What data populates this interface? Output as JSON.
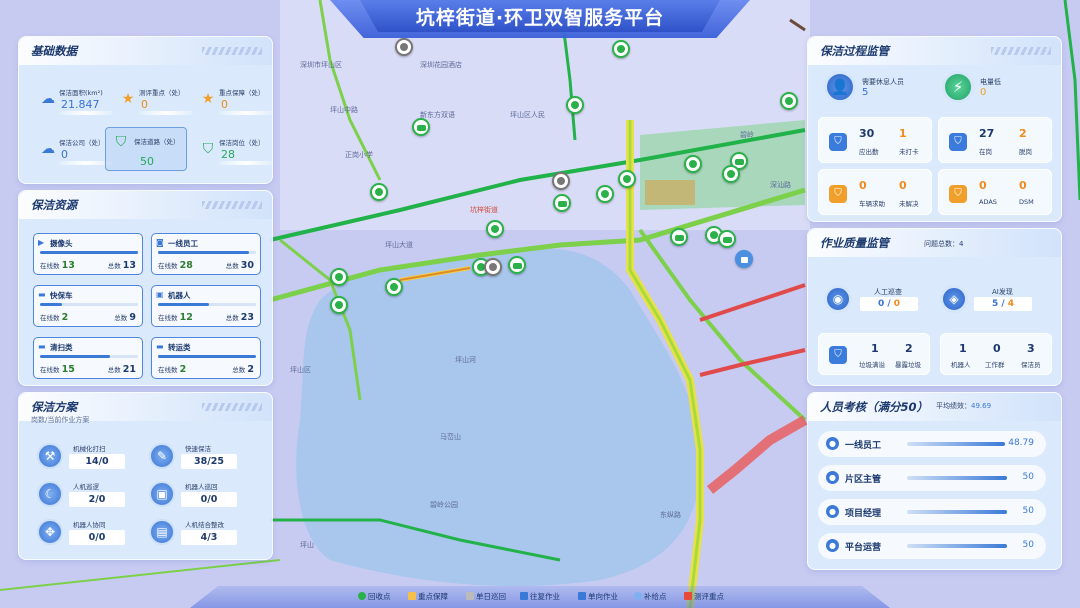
{
  "header": {
    "title": "坑梓街道·环卫双智服务平台"
  },
  "map": {
    "labels": [
      "深圳市坪山区",
      "坪山中路",
      "龙兴路",
      "深圳花园酒店",
      "坪山区人民",
      "新东方双语",
      "深圳·",
      "坪山河",
      "坪山大道",
      "东纵路",
      "深汕路",
      "碧岭",
      "马峦山",
      "坪山区",
      "坪山",
      "正岗小学",
      "碧岭公园"
    ],
    "red_label": "坑梓街道"
  },
  "basic": {
    "title": "基础数据",
    "items": [
      {
        "icon": "cloud-icon",
        "label": "保洁面积(km²)",
        "value": "21.847"
      },
      {
        "icon": "star-icon",
        "label": "测评重点（处）",
        "value": "0"
      },
      {
        "icon": "star-icon",
        "label": "重点保障（处）",
        "value": "0"
      },
      {
        "icon": "cloud-icon",
        "label": "保洁公司（处）",
        "value": "0"
      },
      {
        "icon": "shield-icon",
        "label": "保洁道路（处）",
        "value": "50"
      },
      {
        "icon": "shield-icon",
        "label": "保洁岗位（处）",
        "value": "28"
      }
    ]
  },
  "resources": {
    "title": "保洁资源",
    "online_label": "在线数",
    "total_label": "总数",
    "items": [
      {
        "name": "摄像头",
        "icon": "camera-icon",
        "online": "13",
        "total": "13",
        "ratio": 1.0
      },
      {
        "name": "一线员工",
        "icon": "person-icon",
        "online": "28",
        "total": "30",
        "ratio": 0.93
      },
      {
        "name": "快保车",
        "icon": "truck-icon",
        "online": "2",
        "total": "9",
        "ratio": 0.22
      },
      {
        "name": "机器人",
        "icon": "robot-icon",
        "online": "12",
        "total": "23",
        "ratio": 0.52
      },
      {
        "name": "清扫类",
        "icon": "sweeper-icon",
        "online": "15",
        "total": "21",
        "ratio": 0.71
      },
      {
        "name": "转运类",
        "icon": "transport-icon",
        "online": "2",
        "total": "2",
        "ratio": 1.0
      }
    ]
  },
  "plan": {
    "title": "保洁方案",
    "subtitle": "岗数/当前作业方案",
    "items": [
      {
        "label": "机械化打扫",
        "value": "14/0",
        "icon": "broom-icon"
      },
      {
        "label": "快速保洁",
        "value": "38/25",
        "icon": "brush-icon"
      },
      {
        "label": "人机巡逻",
        "value": "2/0",
        "icon": "patrol-icon"
      },
      {
        "label": "机器人巡回",
        "value": "0/0",
        "icon": "robot-icon"
      },
      {
        "label": "机器人协同",
        "value": "0/0",
        "icon": "network-icon"
      },
      {
        "label": "人机结合整改",
        "value": "4/3",
        "icon": "tablet-icon"
      }
    ]
  },
  "process": {
    "title": "保洁过程监管",
    "top": [
      {
        "label": "需要休息人员",
        "value": "5",
        "icon": "user-icon"
      },
      {
        "label": "电量低",
        "value": "0",
        "icon": "battery-icon"
      }
    ],
    "cards": [
      {
        "icon": "shield-user-icon",
        "a_value": "30",
        "a_label": "应出勤",
        "b_value": "1",
        "b_label": "未打卡",
        "accent": "blue"
      },
      {
        "icon": "shield-user-icon",
        "a_value": "27",
        "a_label": "在岗",
        "b_value": "2",
        "b_label": "脱岗",
        "accent": "blue"
      },
      {
        "icon": "shield-alert-icon",
        "a_value": "0",
        "a_label": "车辆求助",
        "b_value": "0",
        "b_label": "未解决",
        "accent": "orange"
      },
      {
        "icon": "shield-alert-icon",
        "a_value": "0",
        "a_label": "ADAS",
        "b_value": "0",
        "b_label": "DSM",
        "accent": "orange"
      }
    ]
  },
  "quality": {
    "title": "作业质量监管",
    "problems_label": "问题总数：",
    "problems_value": "4",
    "top": [
      {
        "label": "人工巡查",
        "a": "0",
        "b": "0",
        "icon": "person-check-icon"
      },
      {
        "label": "AI发现",
        "a": "5",
        "b": "4",
        "icon": "ai-icon"
      }
    ],
    "cards": [
      {
        "icon": "shield-icon",
        "values": [
          "1",
          "2"
        ],
        "labels": [
          "垃圾满溢",
          "暴露垃圾"
        ]
      },
      {
        "icon": "people-icon",
        "values": [
          "1",
          "0",
          "3"
        ],
        "labels": [
          "机器人",
          "工作群",
          "保洁员"
        ]
      }
    ]
  },
  "assessment": {
    "title": "人员考核（满分50）",
    "avg_label": "平均绩效：",
    "avg_value": "49.69",
    "rows": [
      {
        "name": "一线员工",
        "value": "48.79",
        "ratio": 0.976
      },
      {
        "name": "片区主管",
        "value": "50",
        "ratio": 1.0
      },
      {
        "name": "项目经理",
        "value": "50",
        "ratio": 1.0
      },
      {
        "name": "平台运营",
        "value": "50",
        "ratio": 1.0
      }
    ]
  },
  "legend": {
    "items": [
      {
        "label": "回收点",
        "color": "#2bb14a"
      },
      {
        "label": "重点保障",
        "color": "#f5c04a"
      },
      {
        "label": "单日巡回",
        "color": "#bbbbbb"
      },
      {
        "label": "往复作业",
        "color": "#3a79d8"
      },
      {
        "label": "单向作业",
        "color": "#3a79d8"
      },
      {
        "label": "补给点",
        "color": "#7fb0f0"
      },
      {
        "label": "测评重点",
        "color": "#e84a3a"
      }
    ]
  }
}
